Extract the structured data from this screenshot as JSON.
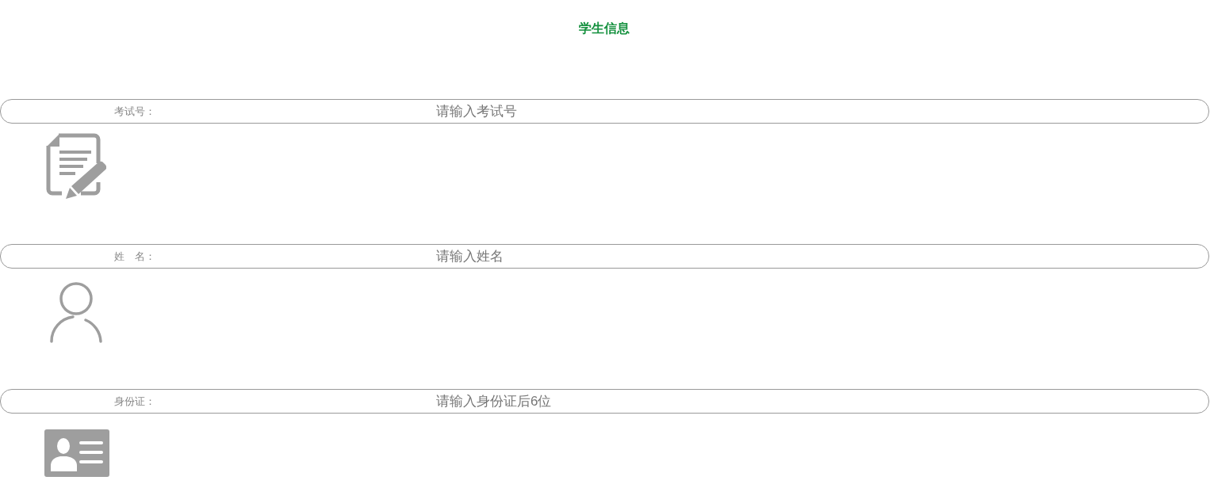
{
  "title": "学生信息",
  "fields": [
    {
      "kind": "exam",
      "label": "考试号：",
      "placeholder": "请输入考试号"
    },
    {
      "kind": "name",
      "label": "姓　名：",
      "placeholder": "请输入姓名"
    },
    {
      "kind": "id",
      "label": "身份证：",
      "placeholder": "请输入身份证后6位"
    }
  ]
}
